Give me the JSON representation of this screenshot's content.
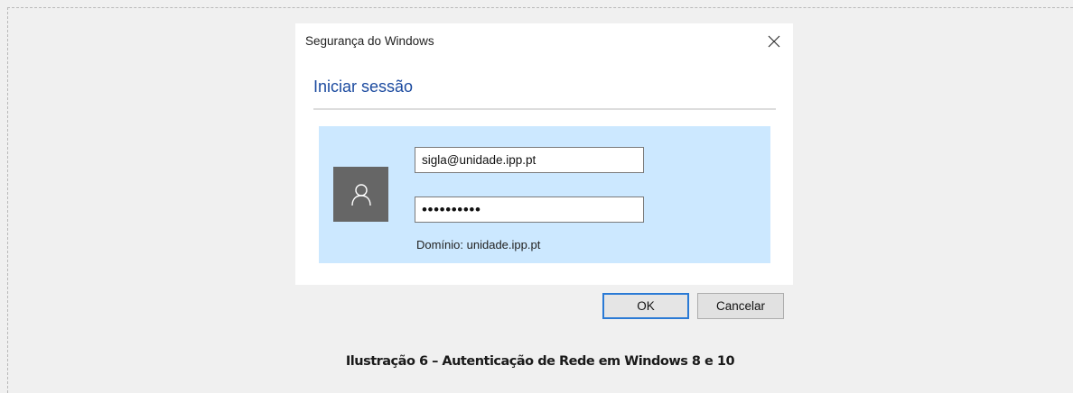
{
  "dialog": {
    "title": "Segurança do Windows",
    "heading": "Iniciar sessão",
    "username_value": "sigla@unidade.ipp.pt",
    "password_mask": "••••••••••",
    "domain_text": "Domínio: unidade.ipp.pt",
    "ok_label": "OK",
    "cancel_label": "Cancelar",
    "icons": {
      "close": "close-icon",
      "avatar": "user-icon"
    },
    "colors": {
      "heading": "#1b4a9f",
      "panel": "#cce8ff",
      "avatar_bg": "#666666",
      "ok_border": "#2a7ad5"
    }
  },
  "caption": "Ilustração 6 – Autenticação de Rede em Windows 8 e 10"
}
